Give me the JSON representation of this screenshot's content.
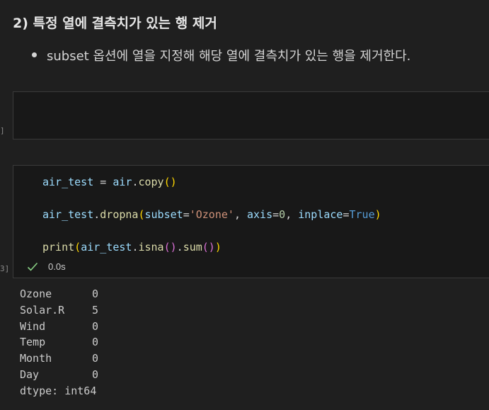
{
  "markdown": {
    "heading": "2) 특정 열에 결측치가 있는 행 제거",
    "bullet": "subset 옵션에 열을 지정해 해당 열에 결측치가 있는 행을 제거한다."
  },
  "cells": [
    {
      "exec_count": "]"
    },
    {
      "exec_count": "3]",
      "code": {
        "l1": {
          "a": "air_test",
          "b": " = ",
          "c": "air",
          "d": ".",
          "e": "copy",
          "f": "()"
        },
        "l2": {
          "a": "air_test",
          "b": ".",
          "c": "dropna",
          "d": "(",
          "e": "subset",
          "f": "=",
          "g": "'Ozone'",
          "h": ", ",
          "i": "axis",
          "j": "=",
          "k": "0",
          "l": ", ",
          "m": "inplace",
          "n": "=",
          "o": "True",
          "p": ")"
        },
        "l3": {
          "a": "print",
          "b": "(",
          "c": "air_test",
          "d": ".",
          "e": "isna",
          "f": "()",
          "g": ".",
          "h": "sum",
          "i": "()",
          "j": ")"
        }
      },
      "status": {
        "icon": "check-icon",
        "time": "0.0s",
        "color": "#89d185"
      },
      "output": {
        "rows": [
          {
            "name": "Ozone",
            "value": "0"
          },
          {
            "name": "Solar.R",
            "value": "5"
          },
          {
            "name": "Wind",
            "value": "0"
          },
          {
            "name": "Temp",
            "value": "0"
          },
          {
            "name": "Month",
            "value": "0"
          },
          {
            "name": "Day",
            "value": "0"
          }
        ],
        "dtype": "dtype: int64"
      }
    }
  ]
}
